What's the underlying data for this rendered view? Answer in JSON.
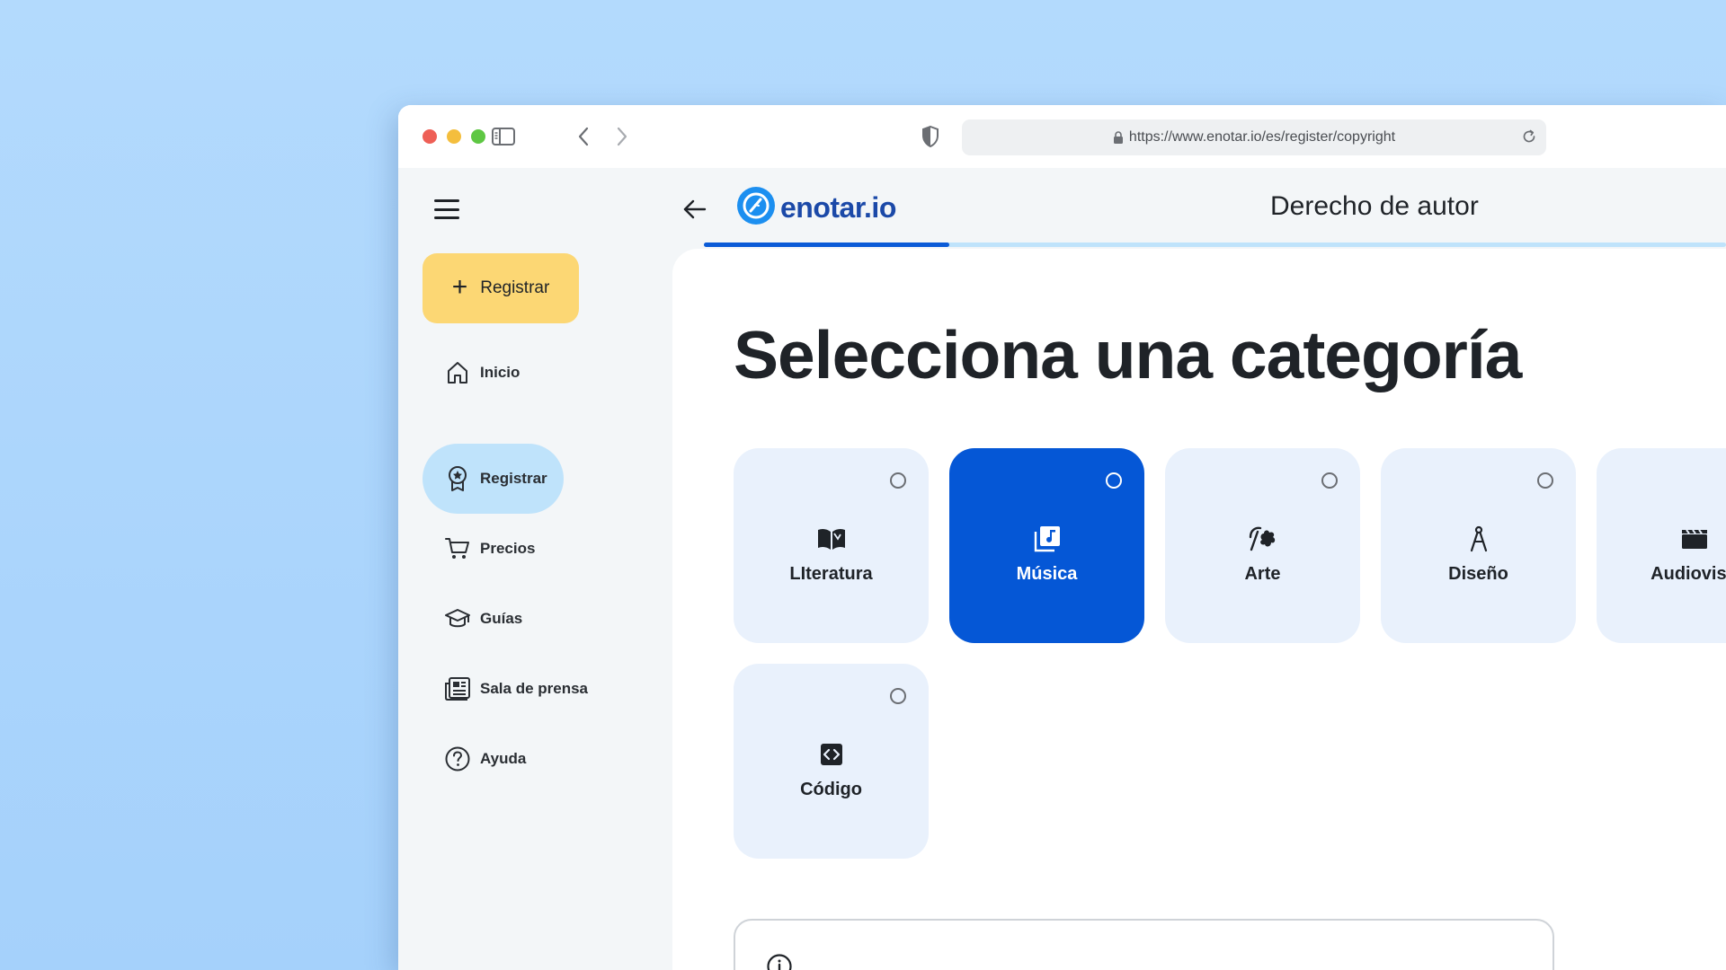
{
  "browser": {
    "url": "https://www.enotar.io/es/register/copyright"
  },
  "sidebar": {
    "cta_label": "Registrar",
    "items": [
      {
        "label": "Inicio",
        "icon": "home-icon",
        "active": false
      },
      {
        "label": "Registrar",
        "icon": "award-icon",
        "active": true
      },
      {
        "label": "Precios",
        "icon": "cart-icon",
        "active": false
      },
      {
        "label": "Guías",
        "icon": "graduation-cap-icon",
        "active": false
      },
      {
        "label": "Sala de prensa",
        "icon": "newspaper-icon",
        "active": false
      },
      {
        "label": "Ayuda",
        "icon": "help-circle-icon",
        "active": false
      }
    ]
  },
  "header": {
    "logo_text": "enotar.io",
    "title": "Derecho de autor",
    "progress": 0.24
  },
  "main": {
    "title": "Selecciona una categoría",
    "categories": [
      {
        "label": "LIteratura",
        "icon": "book-icon",
        "selected": false
      },
      {
        "label": "Música",
        "icon": "music-library-icon",
        "selected": true
      },
      {
        "label": "Arte",
        "icon": "art-icon",
        "selected": false
      },
      {
        "label": "Diseño",
        "icon": "compass-icon",
        "selected": false
      },
      {
        "label": "Audiovisu",
        "icon": "clapperboard-icon",
        "selected": false
      },
      {
        "label": "Código",
        "icon": "code-icon",
        "selected": false
      }
    ]
  },
  "colors": {
    "accent": "#0557d6",
    "cta": "#fcd774",
    "active_nav": "#bfe3fb",
    "card_bg": "#e9f1fc"
  }
}
